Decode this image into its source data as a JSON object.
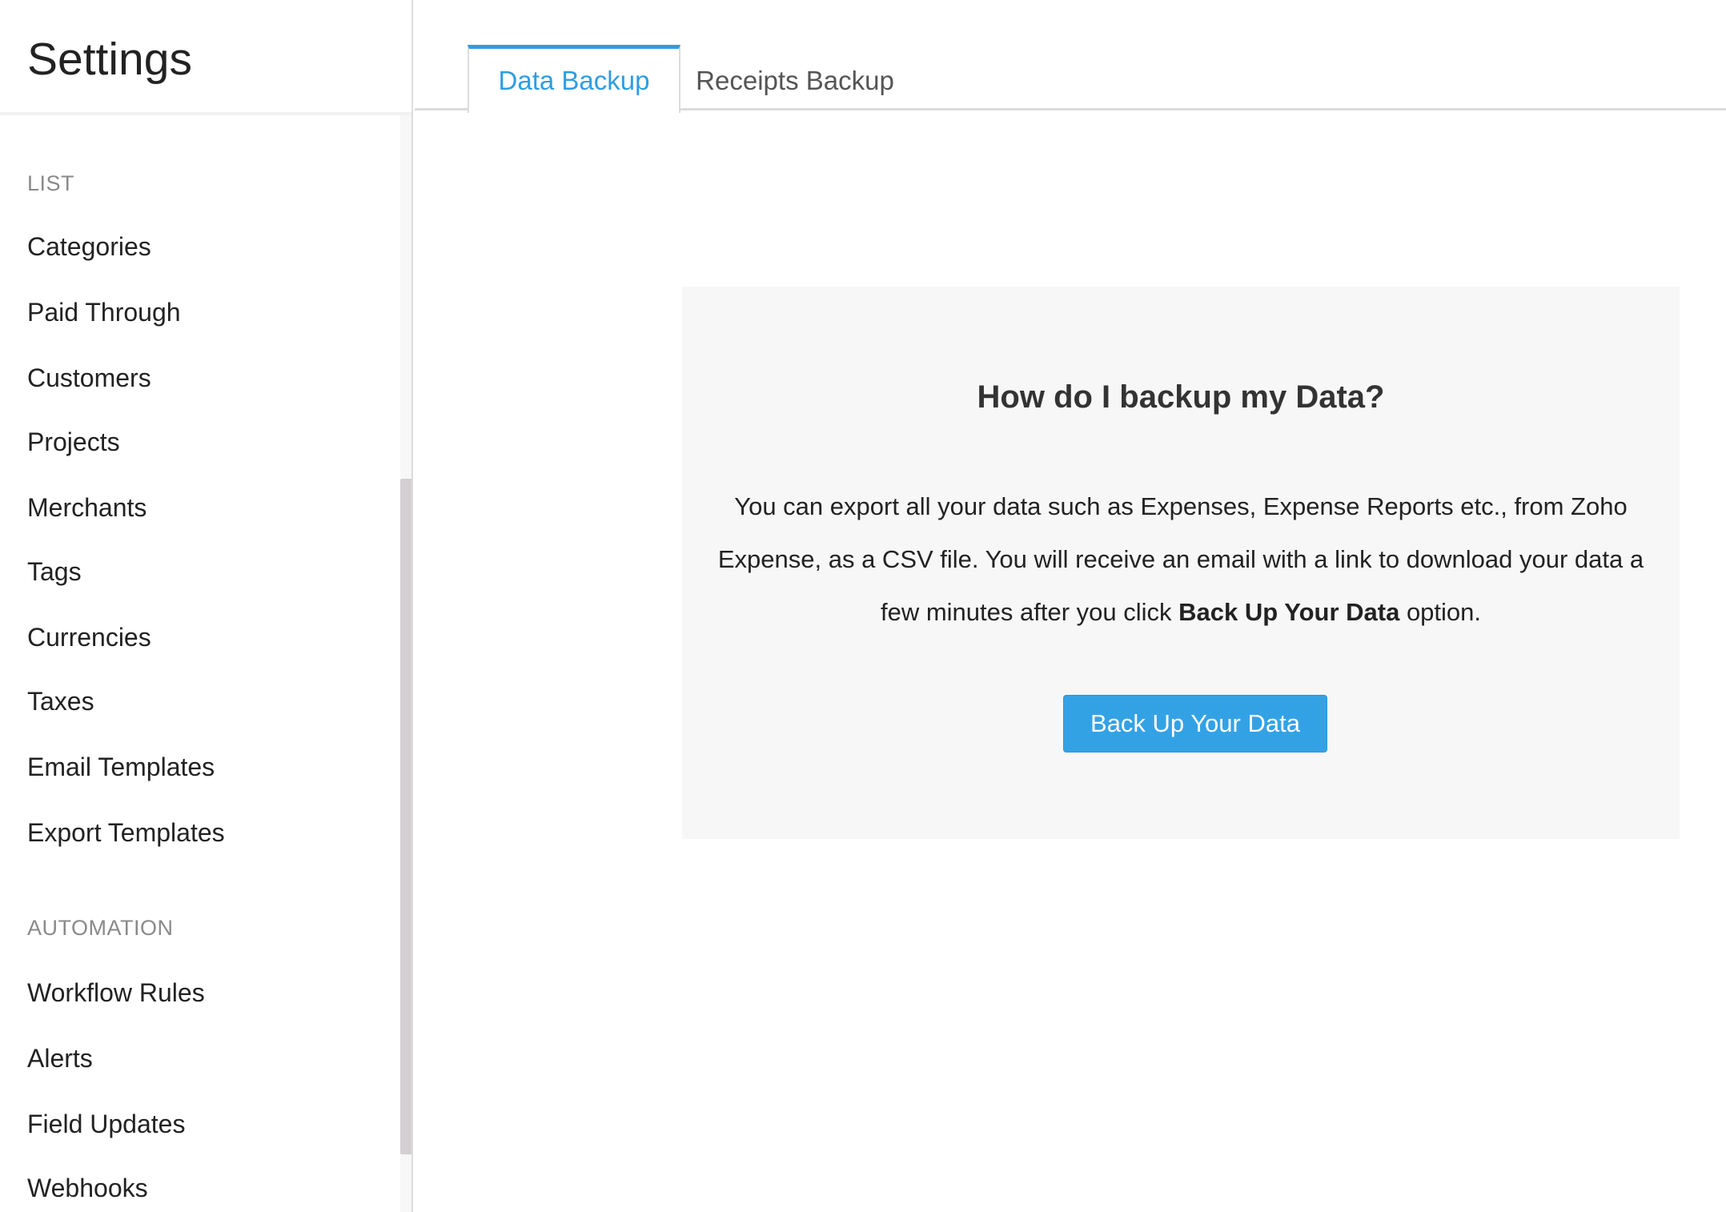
{
  "sidebar": {
    "title": "Settings",
    "sections": [
      {
        "label": "LIST",
        "items": [
          "Categories",
          "Paid Through",
          "Customers",
          "Projects",
          "Merchants",
          "Tags",
          "Currencies",
          "Taxes",
          "Email Templates",
          "Export Templates"
        ]
      },
      {
        "label": "AUTOMATION",
        "items": [
          "Workflow Rules",
          "Alerts",
          "Field Updates",
          "Webhooks"
        ]
      }
    ]
  },
  "tabs": [
    {
      "label": "Data Backup",
      "active": true
    },
    {
      "label": "Receipts Backup",
      "active": false
    }
  ],
  "backup_card": {
    "title": "How do I backup my Data?",
    "description_before": "You can export all your data such as Expenses, Expense Reports etc., from Zoho Expense, as a CSV file. You will receive an email with a link to download your data a few minutes after you click ",
    "description_emphasis": "Back Up Your Data",
    "description_after": " option.",
    "button_label": "Back Up Your Data"
  },
  "colors": {
    "accent": "#2f9de2",
    "button": "#33a2e5",
    "card_background": "#f7f7f7",
    "section_label": "#8a8a8a"
  }
}
